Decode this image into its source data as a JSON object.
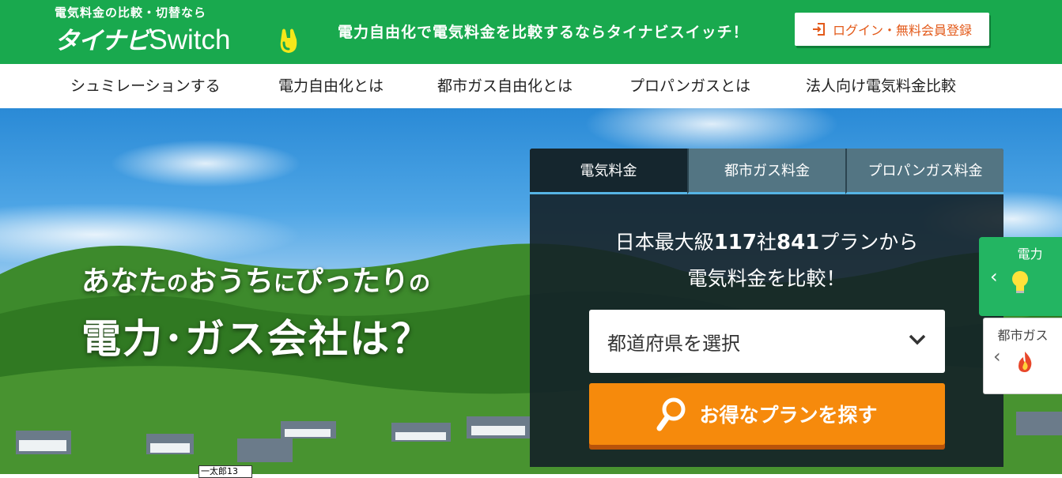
{
  "header": {
    "logo_tagline": "電気料金の比較・切替なら",
    "logo_jp": "タイナビ",
    "logo_en": "Switch",
    "catchphrase": "電力自由化で電気料金を比較するならタイナビスイッチ！",
    "login_label": "ログイン・無料会員登録",
    "colors": {
      "brand_green": "#19a94e",
      "login_text": "#e35a1a"
    }
  },
  "nav": {
    "items": [
      {
        "label": "シュミレーションする"
      },
      {
        "label": "電力自由化とは"
      },
      {
        "label": "都市ガス自由化とは"
      },
      {
        "label": "プロパンガスとは"
      },
      {
        "label": "法人向け電気料金比較"
      }
    ]
  },
  "hero": {
    "line1_a": "あなた",
    "line1_b": "の",
    "line1_c": "おうち",
    "line1_d": "に",
    "line1_e": "ぴったり",
    "line1_f": "の",
    "line2": "電力･ガス会社は？"
  },
  "panel": {
    "tabs": [
      {
        "label": "電気料金",
        "active": true
      },
      {
        "label": "都市ガス料金",
        "active": false
      },
      {
        "label": "プロパンガス料金",
        "active": false
      }
    ],
    "lead_prefix": "日本最大級",
    "lead_companies": "117",
    "lead_companies_unit": "社",
    "lead_plans": "841",
    "lead_suffix": "プランから",
    "lead_line2": "電気料金を比較！",
    "select_value": "都道府県を選択",
    "search_label": "お得なプランを探す",
    "colors": {
      "search_orange": "#f68a0c",
      "tab_underline": "#56b4e4"
    }
  },
  "side": {
    "electric_label": "電力",
    "gas_label": "都市ガス",
    "electric_icon": "lightbulb-icon",
    "gas_icon": "flame-icon"
  },
  "caption": "一太郎13"
}
